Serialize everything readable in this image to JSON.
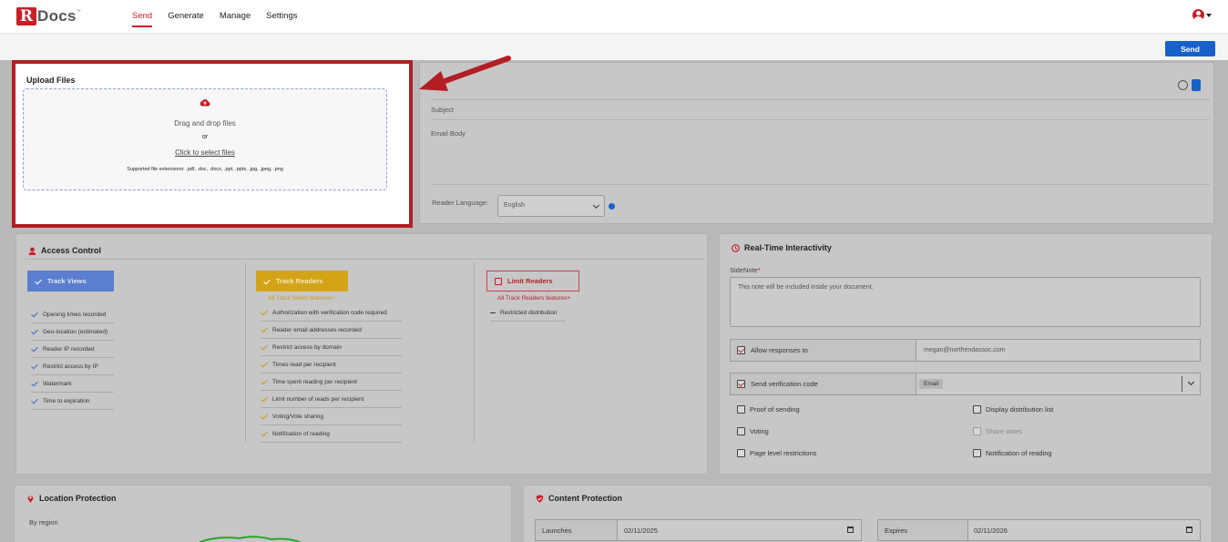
{
  "app": {
    "logo_letter": "R",
    "logo_text": "Docs",
    "logo_tm": "™"
  },
  "nav": {
    "items": [
      "Send",
      "Generate",
      "Manage",
      "Settings"
    ],
    "active": "Send"
  },
  "header": {
    "send_label": "Send"
  },
  "upload": {
    "title": "Upload Files",
    "drag_text": "Drag and drop files",
    "or_text": "or",
    "click_text": "Click to select files",
    "supported_text": "Supported file extensions: .pdf, .doc, .docx, .ppt, .pptx, .jpg, .jpeg, .png"
  },
  "email": {
    "subject_label": "Subject",
    "body_label": "Email Body",
    "language_label": "Reader Language:",
    "language_value": "English"
  },
  "access": {
    "title": "Access Control",
    "track_views": {
      "label": "Track Views",
      "features": [
        "Opening times recorded",
        "Geo-location (estimated)",
        "Reader IP recorded",
        "Restrict access by IP",
        "Watermark",
        "Time to expiration"
      ]
    },
    "track_readers": {
      "label": "Track Readers",
      "note": "All Track Views features+",
      "features": [
        "Authorization with verification code required",
        "Reader email addresses recorded",
        "Restrict access by domain",
        "Times read per recipient",
        "Time spent reading per recipient",
        "Limit number of reads per recipient",
        "Voting/Vote sharing",
        "Notification of reading"
      ]
    },
    "limit_readers": {
      "label": "Limit Readers",
      "note": "All Track Readers features+",
      "features": [
        "Restricted distribution"
      ]
    }
  },
  "realtime": {
    "title": "Real-Time Interactivity",
    "sidenote_label": "SideNote",
    "required_mark": "*",
    "sidenote_placeholder": "This note will be included inside your document.",
    "allow_responses_label": "Allow responses to",
    "allow_responses_value": "megan@northendassoc.com",
    "verification_label": "Send verification code",
    "verification_value": "Email",
    "options": [
      {
        "label": "Proof of sending",
        "checked": false,
        "disabled": false
      },
      {
        "label": "Display distribution list",
        "checked": false,
        "disabled": false
      },
      {
        "label": "Voting",
        "checked": false,
        "disabled": false
      },
      {
        "label": "Share votes",
        "checked": false,
        "disabled": true
      },
      {
        "label": "Page level restrictions",
        "checked": false,
        "disabled": false
      },
      {
        "label": "Notification of reading",
        "checked": false,
        "disabled": false
      }
    ]
  },
  "location": {
    "title": "Location Protection",
    "by_region": "By region"
  },
  "content": {
    "title": "Content Protection",
    "launches_label": "Launches",
    "launches_value": "02/11/2025",
    "expires_label": "Expires",
    "expires_value": "02/11/2026"
  },
  "colors": {
    "brand_red": "#c62026",
    "primary_blue": "#1761c9",
    "track_views_blue": "#5b7ed0",
    "track_readers_gold": "#d3a418"
  }
}
